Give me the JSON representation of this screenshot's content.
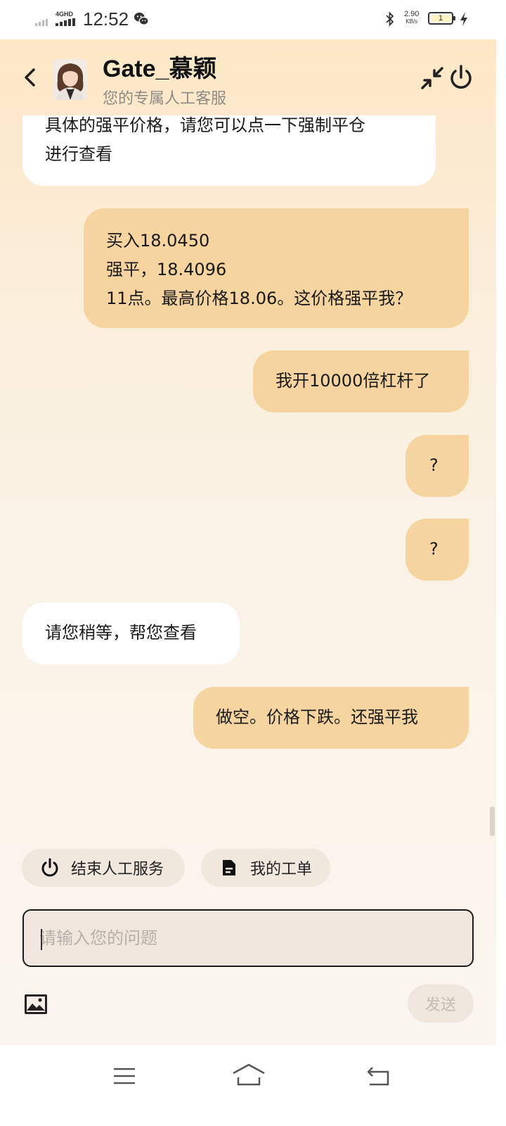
{
  "status_bar": {
    "network": "4GHD",
    "time": "12:52",
    "speed_value": "2.90",
    "speed_unit": "KB/s",
    "battery": "1"
  },
  "header": {
    "agent_name": "Gate_慕颖",
    "agent_subtitle": "您的专属人工客服"
  },
  "messages": [
    {
      "from": "agent",
      "lines": [
        "具体的强平价格，请您可以点一下强制平仓",
        "进行查看"
      ]
    },
    {
      "from": "user",
      "lines": [
        "买入18.0450",
        "强平，18.4096",
        "11点。最高价格18.06。这价格强平我？"
      ]
    },
    {
      "from": "user",
      "lines": [
        "我开10000倍杠杆了"
      ]
    },
    {
      "from": "user",
      "lines": [
        "?"
      ]
    },
    {
      "from": "user",
      "lines": [
        "?"
      ]
    },
    {
      "from": "agent",
      "lines": [
        "请您稍等，帮您查看"
      ]
    },
    {
      "from": "user",
      "lines": [
        "做空。价格下跌。还强平我"
      ]
    }
  ],
  "quick_actions": {
    "end_service": "结束人工服务",
    "my_tickets": "我的工单"
  },
  "composer": {
    "placeholder": "请输入您的问题",
    "value": "",
    "send_label": "发送"
  },
  "colors": {
    "user_bubble": "#f5d49f",
    "agent_bubble": "#ffffff",
    "header_gradient_top": "#fde7c5"
  }
}
